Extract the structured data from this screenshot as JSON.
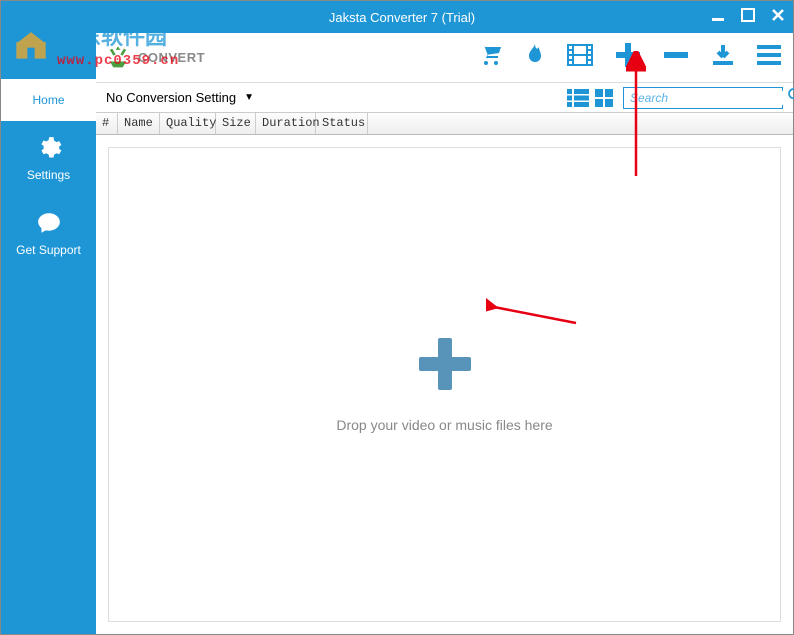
{
  "titlebar": {
    "title": "Jaksta Converter 7 (Trial)"
  },
  "watermark": {
    "site_name": "河东软件园",
    "url": "www.pc0359.cn"
  },
  "sidebar": {
    "items": [
      {
        "label": "Home"
      },
      {
        "label": "Settings"
      },
      {
        "label": "Get Support"
      }
    ]
  },
  "brand": {
    "text": "CONVERT"
  },
  "conversion": {
    "dropdown_label": "No Conversion Setting"
  },
  "search": {
    "placeholder": "Search"
  },
  "table": {
    "headers": {
      "num": "#",
      "name": "Name",
      "quality": "Quality",
      "size": "Size",
      "duration": "Duration",
      "status": "Status"
    }
  },
  "dropzone": {
    "text": "Drop your video or music files here"
  }
}
